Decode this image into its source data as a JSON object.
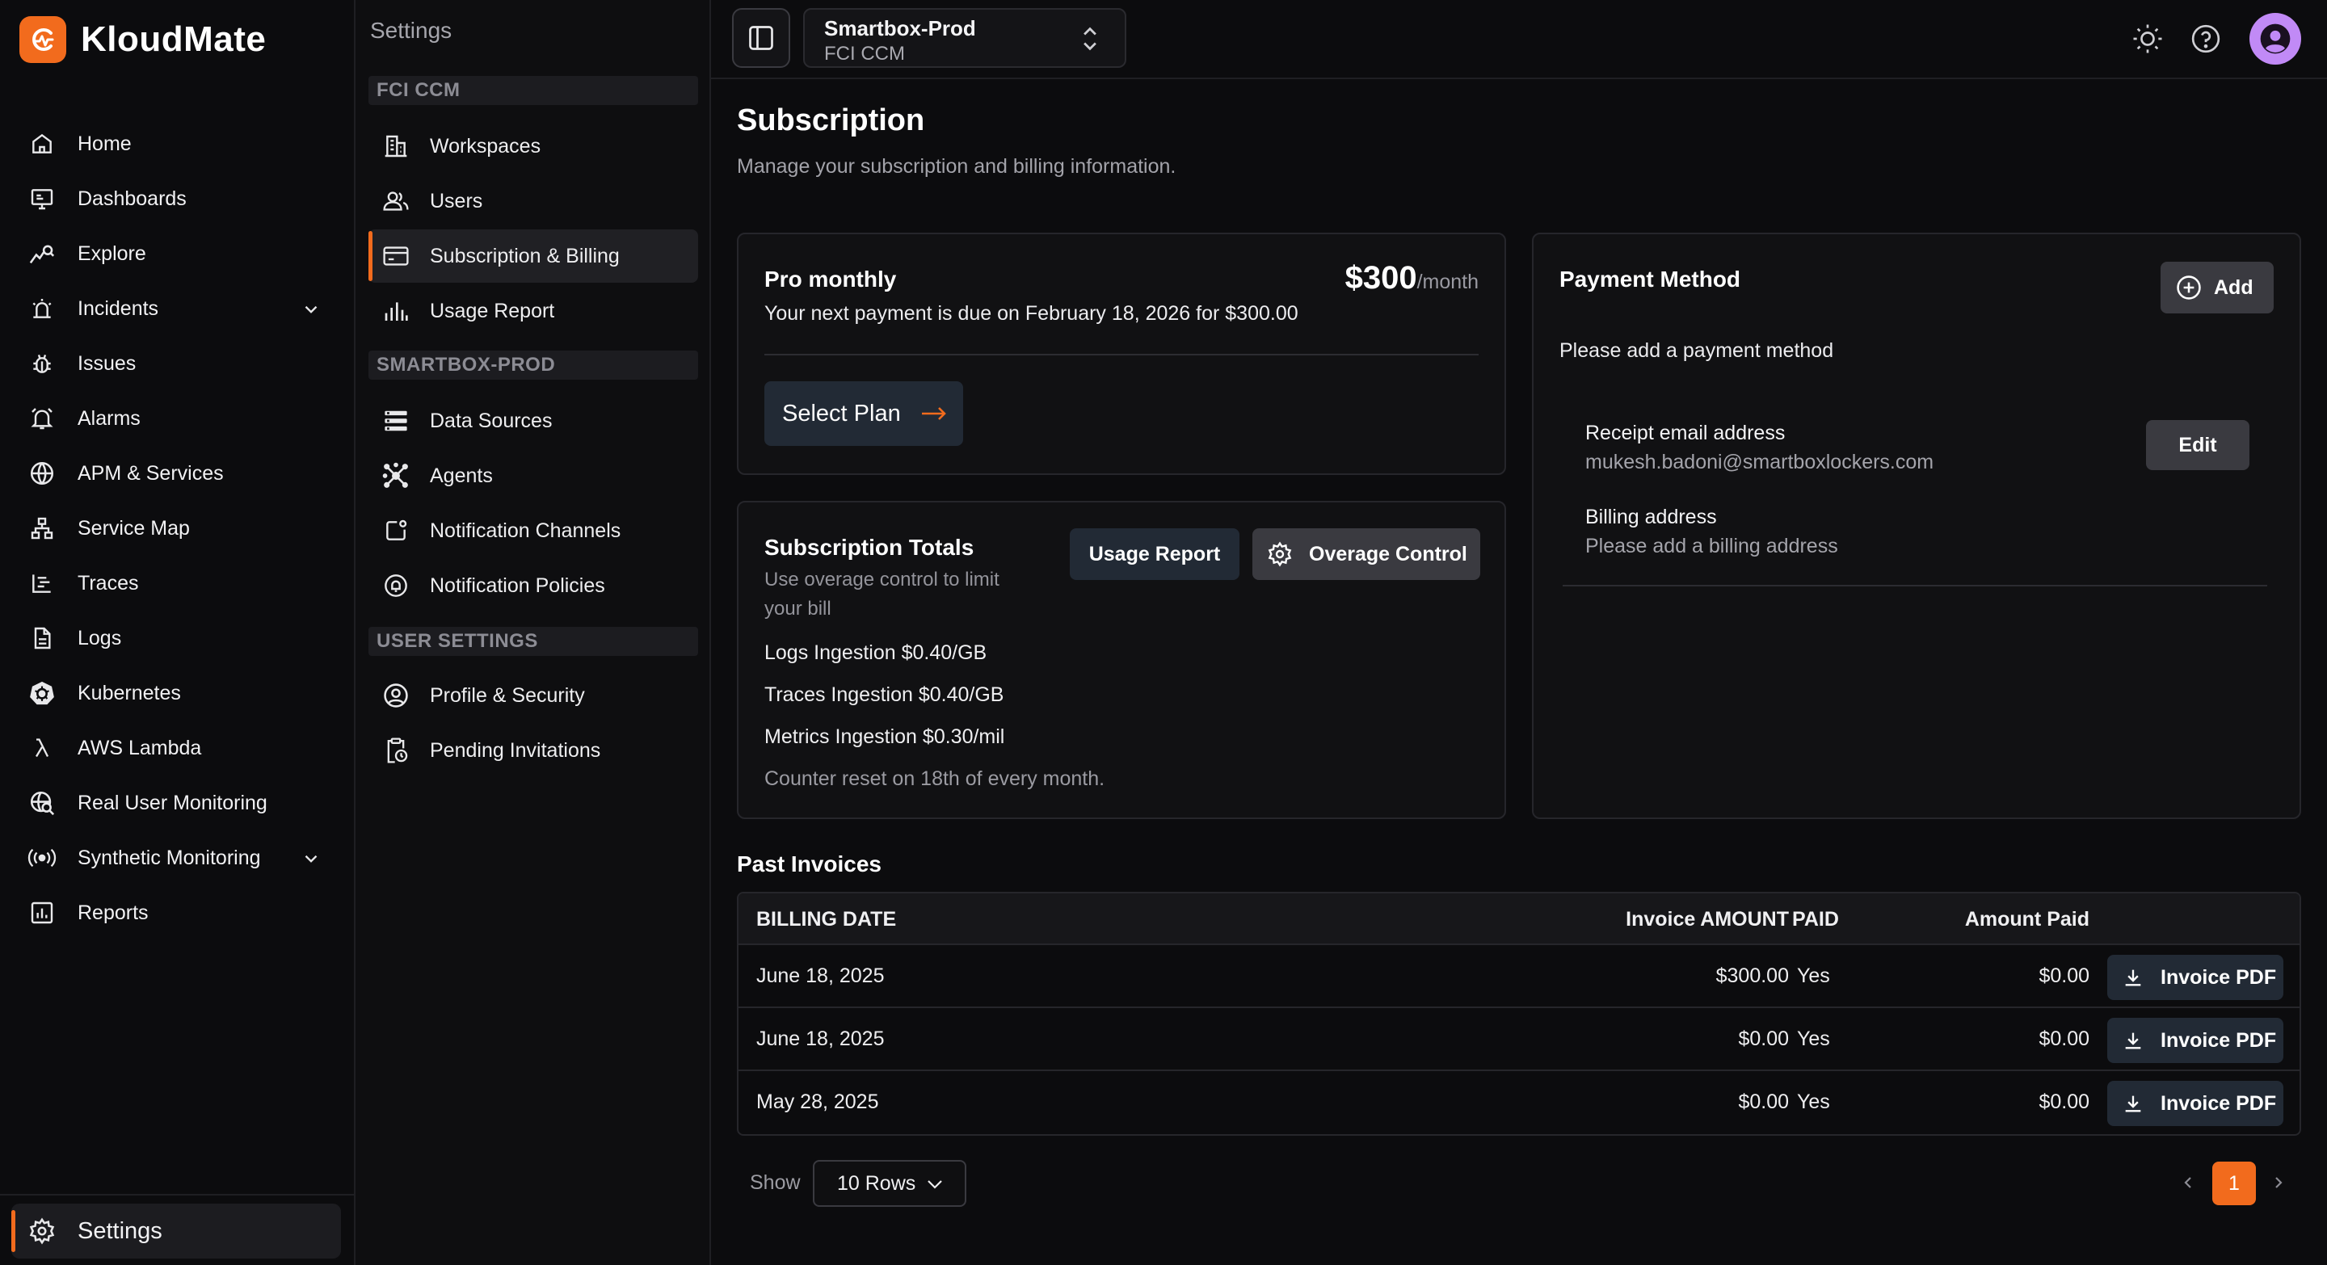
{
  "brand": {
    "name": "KloudMate",
    "accent": "#f26b1d"
  },
  "sidebar": {
    "items": [
      {
        "label": "Home",
        "icon": "home-icon"
      },
      {
        "label": "Dashboards",
        "icon": "dashboard-icon"
      },
      {
        "label": "Explore",
        "icon": "explore-icon"
      },
      {
        "label": "Incidents",
        "icon": "incidents-icon",
        "expandable": true
      },
      {
        "label": "Issues",
        "icon": "bug-icon"
      },
      {
        "label": "Alarms",
        "icon": "alarm-icon"
      },
      {
        "label": "APM & Services",
        "icon": "globe-icon"
      },
      {
        "label": "Service Map",
        "icon": "sitemap-icon"
      },
      {
        "label": "Traces",
        "icon": "traces-icon"
      },
      {
        "label": "Logs",
        "icon": "logs-icon"
      },
      {
        "label": "Kubernetes",
        "icon": "kubernetes-icon"
      },
      {
        "label": "AWS Lambda",
        "icon": "lambda-icon"
      },
      {
        "label": "Real User Monitoring",
        "icon": "rum-icon"
      },
      {
        "label": "Synthetic Monitoring",
        "icon": "broadcast-icon",
        "expandable": true
      },
      {
        "label": "Reports",
        "icon": "reports-icon"
      }
    ],
    "settings_label": "Settings"
  },
  "subnav": {
    "title": "Settings",
    "sections": [
      {
        "title": "FCI CCM",
        "items": [
          {
            "label": "Workspaces",
            "icon": "building-icon"
          },
          {
            "label": "Users",
            "icon": "users-icon"
          },
          {
            "label": "Subscription & Billing",
            "icon": "credit-card-icon",
            "active": true
          },
          {
            "label": "Usage Report",
            "icon": "bar-chart-icon"
          }
        ]
      },
      {
        "title": "SMARTBOX-PROD",
        "items": [
          {
            "label": "Data Sources",
            "icon": "database-icon"
          },
          {
            "label": "Agents",
            "icon": "agents-icon"
          },
          {
            "label": "Notification Channels",
            "icon": "notification-icon"
          },
          {
            "label": "Notification Policies",
            "icon": "policy-icon"
          }
        ]
      },
      {
        "title": "USER SETTINGS",
        "items": [
          {
            "label": "Profile & Security",
            "icon": "profile-icon"
          },
          {
            "label": "Pending Invitations",
            "icon": "clipboard-clock-icon"
          }
        ]
      }
    ]
  },
  "topbar": {
    "workspace_name": "Smartbox-Prod",
    "org_name": "FCI CCM"
  },
  "page": {
    "title": "Subscription",
    "subtitle": "Manage your subscription and billing information."
  },
  "plan": {
    "name": "Pro monthly",
    "price": "$300",
    "period": "/month",
    "due_text": "Your next payment is due on February 18, 2026 for $300.00",
    "select_label": "Select Plan"
  },
  "totals": {
    "title": "Subscription Totals",
    "hint": "Use overage control to limit your bill",
    "usage_report_label": "Usage Report",
    "overage_label": "Overage Control",
    "rates": [
      "Logs Ingestion $0.40/GB",
      "Traces Ingestion $0.40/GB",
      "Metrics Ingestion $0.30/mil"
    ],
    "reset_text": "Counter reset on 18th of every month."
  },
  "payment": {
    "title": "Payment Method",
    "add_label": "Add",
    "hint": "Please add a payment method",
    "receipt_label": "Receipt email address",
    "receipt_email": "mukesh.badoni@smartboxlockers.com",
    "edit_label": "Edit",
    "billing_label": "Billing address",
    "billing_value": "Please add a billing address"
  },
  "invoices": {
    "title": "Past Invoices",
    "columns": [
      "BILLING DATE",
      "Invoice AMOUNT",
      "Amount Paid",
      "PAID"
    ],
    "pdf_label": "Invoice PDF",
    "rows": [
      {
        "date": "June 18, 2025",
        "amount": "$300.00",
        "paid_amount": "$0.00",
        "paid": "Yes"
      },
      {
        "date": "June 18, 2025",
        "amount": "$0.00",
        "paid_amount": "$0.00",
        "paid": "Yes"
      },
      {
        "date": "May 28, 2025",
        "amount": "$0.00",
        "paid_amount": "$0.00",
        "paid": "Yes"
      }
    ]
  },
  "pagination": {
    "show_label": "Show",
    "rows_option": "10 Rows",
    "current_page": "1"
  }
}
